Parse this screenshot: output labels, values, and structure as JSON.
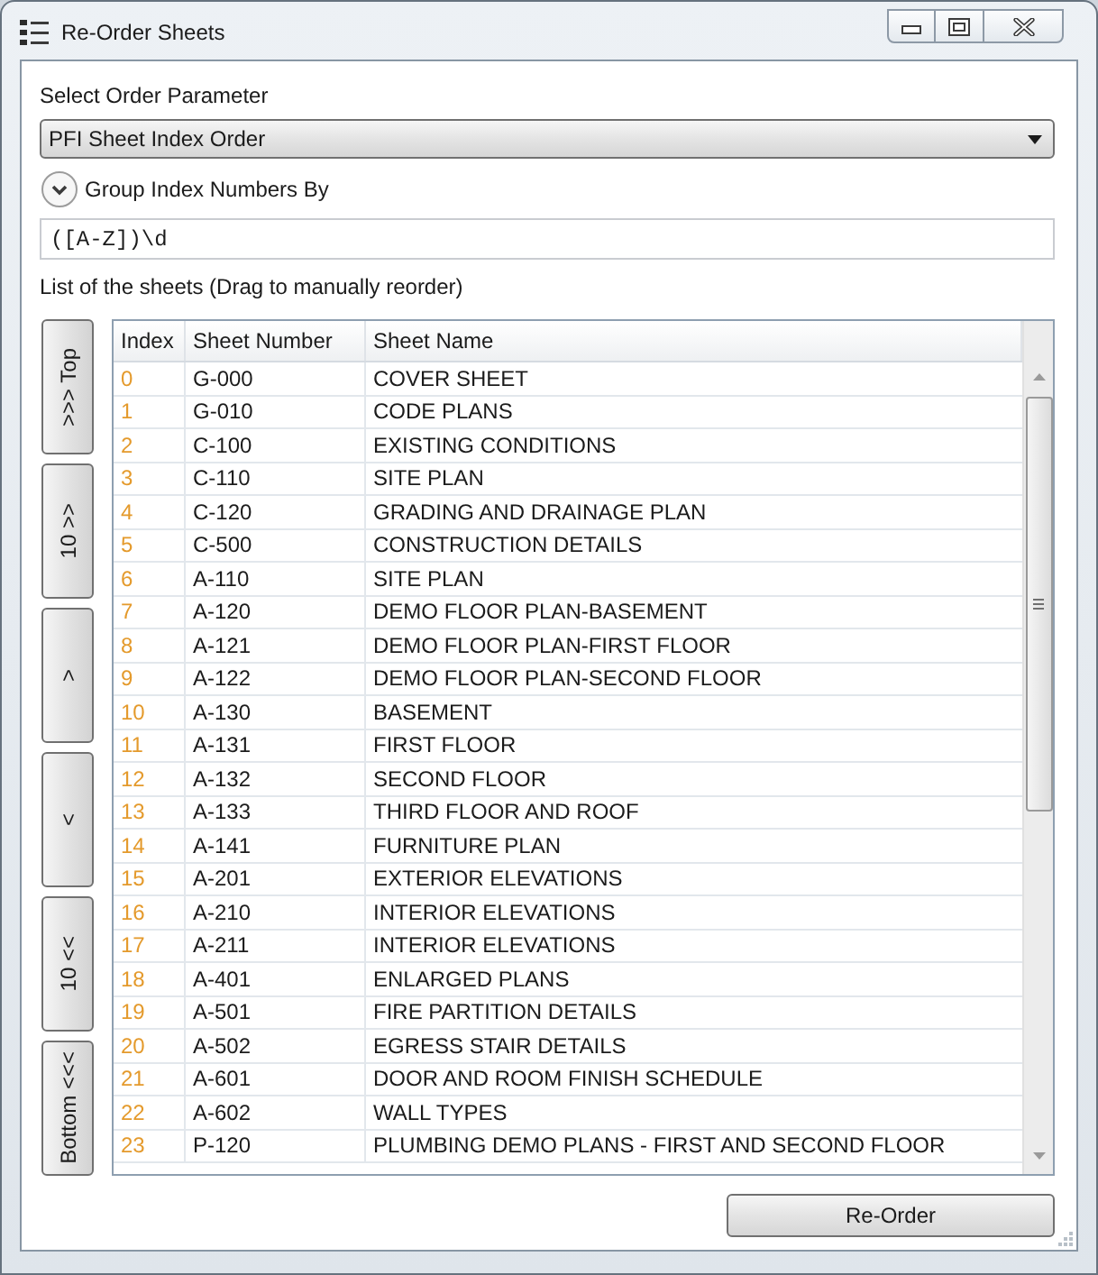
{
  "window": {
    "title": "Re-Order Sheets"
  },
  "order_parameter": {
    "label": "Select Order Parameter",
    "value": "PFI Sheet Index Order"
  },
  "group_index": {
    "label": "Group Index Numbers By",
    "pattern": "([A-Z])\\d"
  },
  "sheet_list": {
    "label": "List of the sheets (Drag to manually reorder)"
  },
  "move_buttons": [
    ">>> Top",
    "10 >>",
    ">",
    "<",
    "10 <<",
    "Bottom <<<"
  ],
  "table": {
    "columns": [
      "Index",
      "Sheet Number",
      "Sheet Name"
    ],
    "rows": [
      {
        "index": "0",
        "number": "G-000",
        "name": "COVER SHEET"
      },
      {
        "index": "1",
        "number": "G-010",
        "name": "CODE PLANS"
      },
      {
        "index": "2",
        "number": "C-100",
        "name": "EXISTING CONDITIONS"
      },
      {
        "index": "3",
        "number": "C-110",
        "name": "SITE PLAN"
      },
      {
        "index": "4",
        "number": "C-120",
        "name": "GRADING AND DRAINAGE PLAN"
      },
      {
        "index": "5",
        "number": "C-500",
        "name": "CONSTRUCTION DETAILS"
      },
      {
        "index": "6",
        "number": "A-110",
        "name": "SITE PLAN"
      },
      {
        "index": "7",
        "number": "A-120",
        "name": "DEMO FLOOR PLAN-BASEMENT"
      },
      {
        "index": "8",
        "number": "A-121",
        "name": "DEMO FLOOR PLAN-FIRST FLOOR"
      },
      {
        "index": "9",
        "number": "A-122",
        "name": "DEMO FLOOR PLAN-SECOND FLOOR"
      },
      {
        "index": "10",
        "number": "A-130",
        "name": "BASEMENT"
      },
      {
        "index": "11",
        "number": "A-131",
        "name": "FIRST FLOOR"
      },
      {
        "index": "12",
        "number": "A-132",
        "name": "SECOND FLOOR"
      },
      {
        "index": "13",
        "number": "A-133",
        "name": "THIRD FLOOR AND ROOF"
      },
      {
        "index": "14",
        "number": "A-141",
        "name": "FURNITURE PLAN"
      },
      {
        "index": "15",
        "number": "A-201",
        "name": "EXTERIOR ELEVATIONS"
      },
      {
        "index": "16",
        "number": "A-210",
        "name": "INTERIOR ELEVATIONS"
      },
      {
        "index": "17",
        "number": "A-211",
        "name": "INTERIOR ELEVATIONS"
      },
      {
        "index": "18",
        "number": "A-401",
        "name": "ENLARGED PLANS"
      },
      {
        "index": "19",
        "number": "A-501",
        "name": "FIRE PARTITION DETAILS"
      },
      {
        "index": "20",
        "number": "A-502",
        "name": "EGRESS STAIR DETAILS"
      },
      {
        "index": "21",
        "number": "A-601",
        "name": "DOOR AND ROOM FINISH SCHEDULE"
      },
      {
        "index": "22",
        "number": "A-602",
        "name": "WALL TYPES"
      },
      {
        "index": "23",
        "number": "P-120",
        "name": "PLUMBING DEMO PLANS - FIRST AND SECOND FLOOR"
      }
    ]
  },
  "buttons": [
    "Re-Order"
  ]
}
